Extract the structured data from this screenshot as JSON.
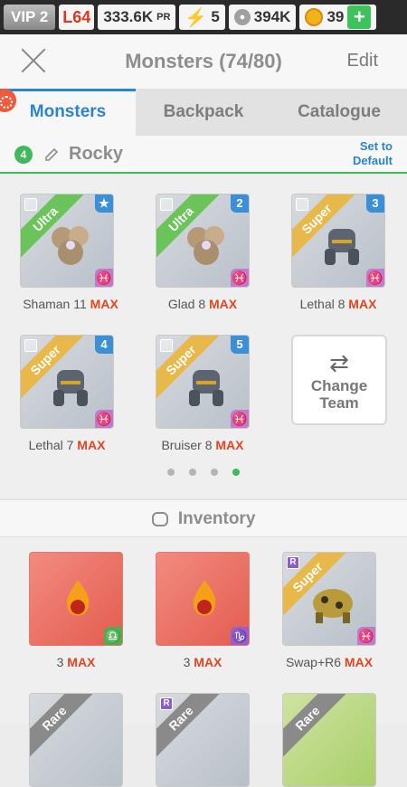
{
  "status": {
    "vip": "VIP 2",
    "level": "L64",
    "power": "333.6K",
    "power_unit": "PR",
    "energy": "5",
    "food": "394K",
    "gold": "39"
  },
  "header": {
    "title": "Monsters (74/80)",
    "edit": "Edit"
  },
  "tabs": [
    {
      "label": "Monsters"
    },
    {
      "label": "Backpack"
    },
    {
      "label": "Catalogue"
    }
  ],
  "team": {
    "number": "4",
    "name": "Rocky",
    "default_line1": "Set to",
    "default_line2": "Default"
  },
  "monsters": [
    {
      "tier": "Ultra",
      "slot": "★",
      "name": "Shaman 11",
      "max": "MAX"
    },
    {
      "tier": "Ultra",
      "slot": "2",
      "name": "Glad 8",
      "max": "MAX"
    },
    {
      "tier": "Super",
      "slot": "3",
      "name": "Lethal 8",
      "max": "MAX"
    },
    {
      "tier": "Super",
      "slot": "4",
      "name": "Lethal 7",
      "max": "MAX"
    },
    {
      "tier": "Super",
      "slot": "5",
      "name": "Bruiser 8",
      "max": "MAX"
    }
  ],
  "change_team": {
    "line1": "Change",
    "line2": "Team"
  },
  "inventory": {
    "title": "Inventory",
    "items": [
      {
        "tier": "",
        "name": "3",
        "max": "MAX"
      },
      {
        "tier": "",
        "name": "3",
        "max": "MAX"
      },
      {
        "tier": "Super",
        "name": "Swap+R6",
        "max": "MAX"
      }
    ],
    "partial": [
      {
        "tier": "Rare"
      },
      {
        "tier": "Rare"
      },
      {
        "tier": "Rare"
      }
    ]
  },
  "colors": {
    "accent": "#2b85c9",
    "max": "#e0461f",
    "team_green": "#3fb95a"
  }
}
